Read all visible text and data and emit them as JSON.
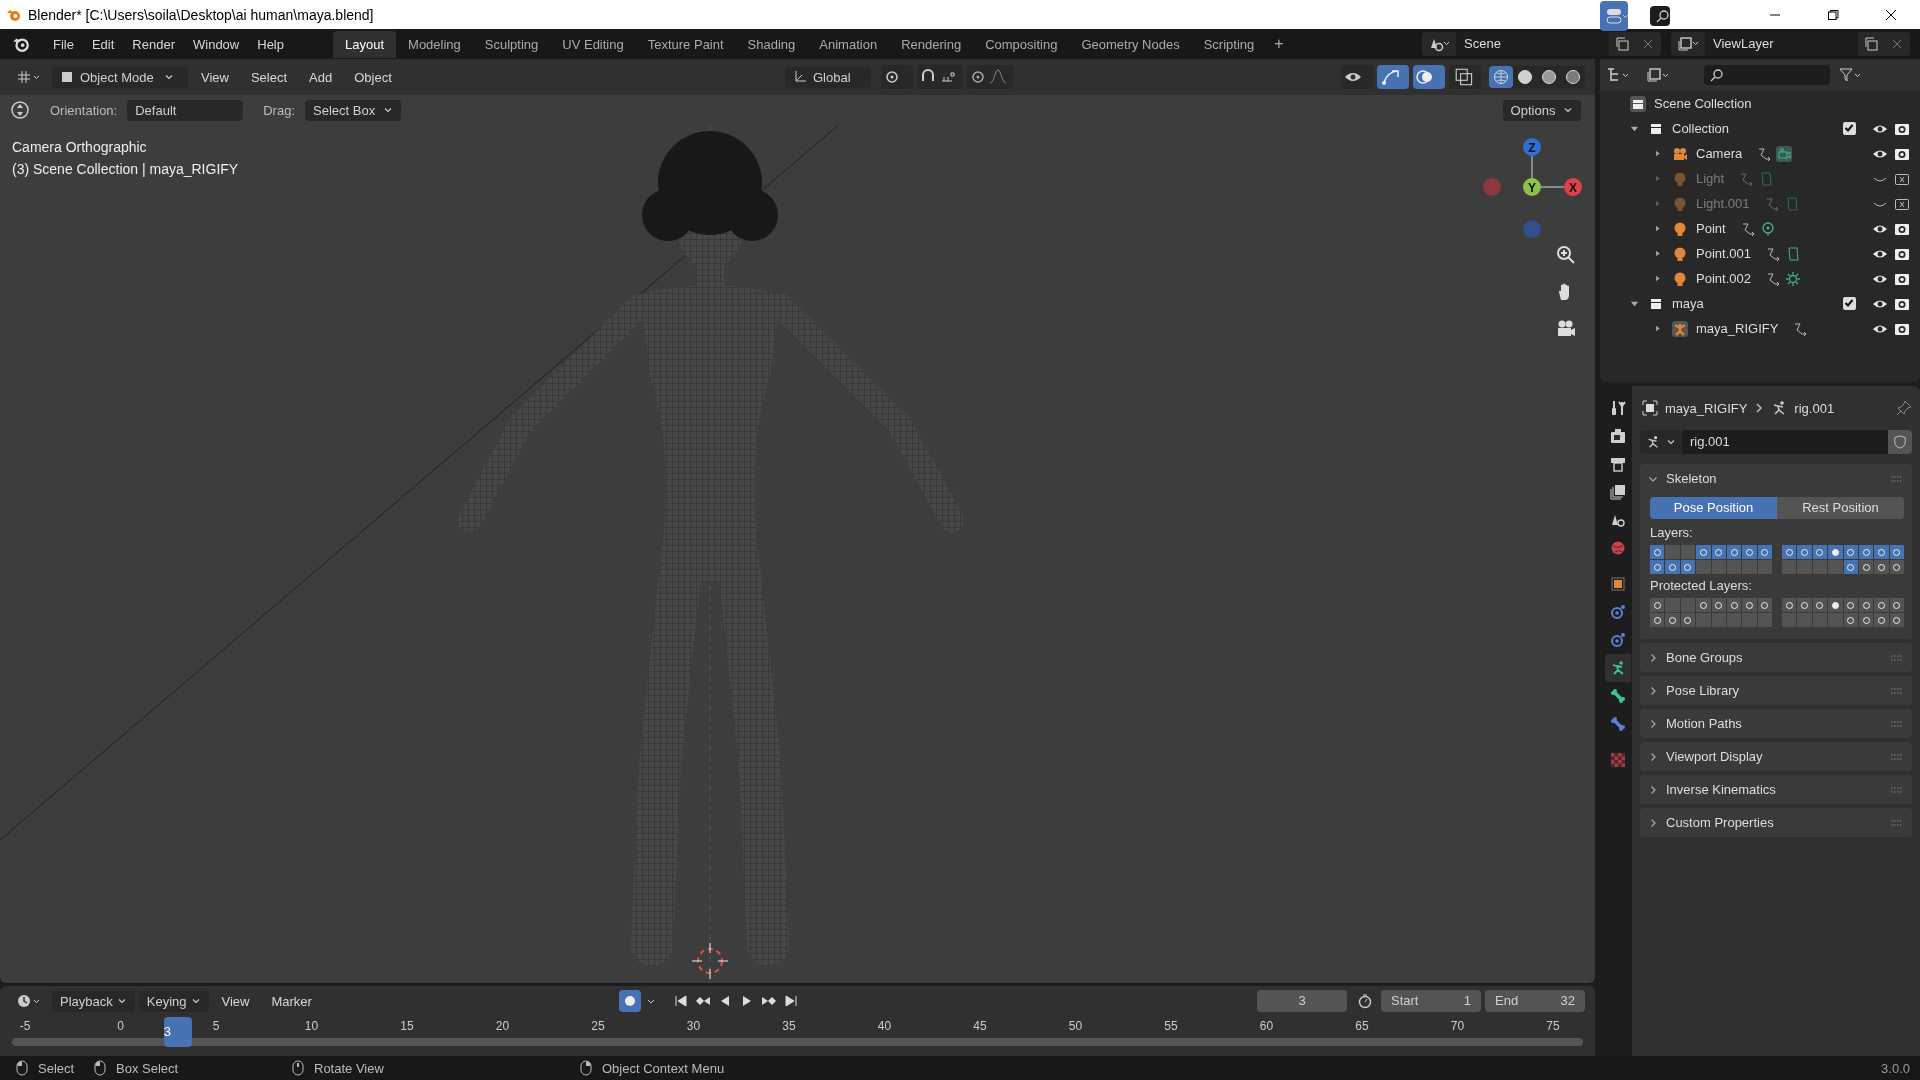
{
  "window": {
    "title": "Blender* [C:\\Users\\soila\\Desktop\\ai human\\maya.blend]"
  },
  "menu": [
    "File",
    "Edit",
    "Render",
    "Window",
    "Help"
  ],
  "workspaces": [
    {
      "label": "Layout",
      "selected": true
    },
    {
      "label": "Modeling",
      "selected": false
    },
    {
      "label": "Sculpting",
      "selected": false
    },
    {
      "label": "UV Editing",
      "selected": false
    },
    {
      "label": "Texture Paint",
      "selected": false
    },
    {
      "label": "Shading",
      "selected": false
    },
    {
      "label": "Animation",
      "selected": false
    },
    {
      "label": "Rendering",
      "selected": false
    },
    {
      "label": "Compositing",
      "selected": false
    },
    {
      "label": "Geometry Nodes",
      "selected": false
    },
    {
      "label": "Scripting",
      "selected": false
    }
  ],
  "add_workspace": "+",
  "scene": "Scene",
  "view_layer": "ViewLayer",
  "viewport": {
    "mode": "Object Mode",
    "menu": [
      "View",
      "Select",
      "Add",
      "Object"
    ],
    "transform_orientation": "Global",
    "gizmo_on": true,
    "overlays_on": true,
    "shading": [
      {
        "kind": "wireframe",
        "selected": true
      },
      {
        "kind": "solid",
        "selected": false
      },
      {
        "kind": "material",
        "selected": false
      },
      {
        "kind": "rendered",
        "selected": false
      }
    ],
    "orientation_label": "Orientation:",
    "orientation": "Default",
    "drag_label": "Drag:",
    "drag": "Select Box",
    "options": "Options",
    "info": [
      "Camera Orthographic",
      "(3) Scene Collection | maya_RIGIFY"
    ],
    "axes": [
      {
        "label": "Z",
        "color": "#2f6fd4"
      },
      {
        "label": "Y",
        "color": "#8bc34a"
      },
      {
        "label": "X",
        "color": "#e0404a"
      }
    ]
  },
  "outliner": {
    "root": "Scene Collection",
    "items": [
      {
        "name": "Collection",
        "kind": "collection",
        "expanded": true,
        "checked": true,
        "visible": true,
        "children": [
          {
            "name": "Camera",
            "kind": "camera",
            "data_block": {
              "kind": "camera"
            },
            "expanded": false,
            "visible": true
          },
          {
            "name": "Light",
            "kind": "light",
            "data_block": {
              "kind": "area"
            },
            "expanded": false,
            "visible": false
          },
          {
            "name": "Light.001",
            "kind": "light",
            "data_block": {
              "kind": "area"
            },
            "expanded": false,
            "visible": false
          },
          {
            "name": "Point",
            "kind": "light",
            "data_block": {
              "kind": "point"
            },
            "expanded": false,
            "visible": true
          },
          {
            "name": "Point.001",
            "kind": "light",
            "data_block": {
              "kind": "area"
            },
            "expanded": false,
            "visible": true
          },
          {
            "name": "Point.002",
            "kind": "light",
            "data_block": {
              "kind": "sun"
            },
            "expanded": false,
            "visible": true
          }
        ]
      },
      {
        "name": "maya",
        "kind": "collection",
        "expanded": true,
        "checked": true,
        "visible": true,
        "children": [
          {
            "name": "maya_RIGIFY",
            "kind": "armature",
            "expanded": false,
            "visible": true
          }
        ]
      }
    ]
  },
  "properties": {
    "tabs": [
      {
        "kind": "tool",
        "selected": false
      },
      {
        "kind": "render",
        "selected": false
      },
      {
        "kind": "output",
        "selected": false
      },
      {
        "kind": "view_layer",
        "selected": false
      },
      {
        "kind": "scene",
        "selected": false
      },
      {
        "kind": "world",
        "selected": false
      },
      {
        "kind": "object",
        "selected": false
      },
      {
        "kind": "physics",
        "selected": false
      },
      {
        "kind": "constraints",
        "selected": false
      },
      {
        "kind": "armature",
        "selected": true
      },
      {
        "kind": "bone",
        "selected": false
      },
      {
        "kind": "bone_constraints",
        "selected": false
      },
      {
        "kind": "texture",
        "selected": false
      }
    ],
    "breadcrumb": [
      "maya_RIGIFY",
      "rig.001"
    ],
    "datablock": "rig.001",
    "skeleton": {
      "title": "Skeleton",
      "expanded": true,
      "positions": [
        {
          "label": "Pose Position",
          "selected": true
        },
        {
          "label": "Rest Position",
          "selected": false
        }
      ],
      "layers_label": "Layers:",
      "layers": [
        [
          [
            {
              "selected": true,
              "kind": "ring"
            },
            {
              "selected": false,
              "kind": "empty"
            },
            {
              "selected": false,
              "kind": "empty"
            },
            {
              "selected": true,
              "kind": "ring"
            },
            {
              "selected": true,
              "kind": "ring"
            },
            {
              "selected": true,
              "kind": "ring"
            },
            {
              "selected": true,
              "kind": "ring"
            },
            {
              "selected": true,
              "kind": "ring"
            }
          ],
          [
            {
              "selected": true,
              "kind": "ring"
            },
            {
              "selected": true,
              "kind": "ring"
            },
            {
              "selected": true,
              "kind": "ring"
            },
            {
              "selected": false,
              "kind": "empty"
            },
            {
              "selected": false,
              "kind": "empty"
            },
            {
              "selected": false,
              "kind": "empty"
            },
            {
              "selected": false,
              "kind": "empty"
            },
            {
              "selected": false,
              "kind": "empty"
            }
          ]
        ],
        [
          [
            {
              "selected": true,
              "kind": "ring"
            },
            {
              "selected": true,
              "kind": "ring"
            },
            {
              "selected": true,
              "kind": "ring"
            },
            {
              "selected": true,
              "kind": "fill"
            },
            {
              "selected": true,
              "kind": "ring"
            },
            {
              "selected": true,
              "kind": "ring"
            },
            {
              "selected": true,
              "kind": "ring"
            },
            {
              "selected": true,
              "kind": "ring"
            }
          ],
          [
            {
              "selected": false,
              "kind": "empty"
            },
            {
              "selected": false,
              "kind": "empty"
            },
            {
              "selected": false,
              "kind": "empty"
            },
            {
              "selected": false,
              "kind": "empty"
            },
            {
              "selected": true,
              "kind": "ring"
            },
            {
              "selected": false,
              "kind": "ring"
            },
            {
              "selected": false,
              "kind": "ring"
            },
            {
              "selected": false,
              "kind": "ring"
            }
          ]
        ]
      ],
      "protected_label": "Protected Layers:",
      "protected": [
        [
          [
            {
              "selected": false,
              "kind": "ring"
            },
            {
              "selected": false,
              "kind": "empty"
            },
            {
              "selected": false,
              "kind": "empty"
            },
            {
              "selected": false,
              "kind": "ring"
            },
            {
              "selected": false,
              "kind": "ring"
            },
            {
              "selected": false,
              "kind": "ring"
            },
            {
              "selected": false,
              "kind": "ring"
            },
            {
              "selected": false,
              "kind": "ring"
            }
          ],
          [
            {
              "selected": false,
              "kind": "ring"
            },
            {
              "selected": false,
              "kind": "ring"
            },
            {
              "selected": false,
              "kind": "ring"
            },
            {
              "selected": false,
              "kind": "empty"
            },
            {
              "selected": false,
              "kind": "empty"
            },
            {
              "selected": false,
              "kind": "empty"
            },
            {
              "selected": false,
              "kind": "empty"
            },
            {
              "selected": false,
              "kind": "empty"
            }
          ]
        ],
        [
          [
            {
              "selected": false,
              "kind": "ring"
            },
            {
              "selected": false,
              "kind": "ring"
            },
            {
              "selected": false,
              "kind": "ring"
            },
            {
              "selected": false,
              "kind": "fill"
            },
            {
              "selected": false,
              "kind": "ring"
            },
            {
              "selected": false,
              "kind": "ring"
            },
            {
              "selected": false,
              "kind": "ring"
            },
            {
              "selected": false,
              "kind": "ring"
            }
          ],
          [
            {
              "selected": false,
              "kind": "empty"
            },
            {
              "selected": false,
              "kind": "empty"
            },
            {
              "selected": false,
              "kind": "empty"
            },
            {
              "selected": false,
              "kind": "empty"
            },
            {
              "selected": false,
              "kind": "ring"
            },
            {
              "selected": false,
              "kind": "ring"
            },
            {
              "selected": false,
              "kind": "ring"
            },
            {
              "selected": false,
              "kind": "ring"
            }
          ]
        ]
      ]
    },
    "panels": [
      {
        "title": "Bone Groups",
        "expanded": false
      },
      {
        "title": "Pose Library",
        "expanded": false
      },
      {
        "title": "Motion Paths",
        "expanded": false
      },
      {
        "title": "Viewport Display",
        "expanded": false
      },
      {
        "title": "Inverse Kinematics",
        "expanded": false
      },
      {
        "title": "Custom Properties",
        "expanded": false
      }
    ]
  },
  "timeline": {
    "menus": [
      "Playback",
      "Keying",
      "View",
      "Marker"
    ],
    "auto_keying": true,
    "current_frame": "3",
    "start_label": "Start",
    "start": "1",
    "end_label": "End",
    "end": "32",
    "playhead": {
      "label": "3",
      "level": 0.1
    },
    "ruler": [
      "-5",
      "0",
      "5",
      "10",
      "15",
      "20",
      "25",
      "30",
      "35",
      "40",
      "45",
      "50",
      "55",
      "60",
      "65",
      "70",
      "75"
    ]
  },
  "status_bar": {
    "items": [
      {
        "label": "Select",
        "kind": "left"
      },
      {
        "label": "Box Select",
        "kind": "drag"
      },
      {
        "label": "Rotate View",
        "kind": "middle"
      },
      {
        "label": "Object Context Menu",
        "kind": "right"
      }
    ],
    "version": "3.0.0"
  }
}
